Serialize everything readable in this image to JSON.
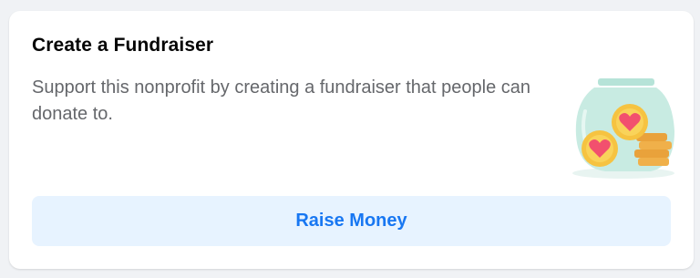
{
  "card": {
    "title": "Create a Fundraiser",
    "description": "Support this nonprofit by creating a fundraiser that people can donate to.",
    "illustration_icon": "donation-jar-icon",
    "button_label": "Raise Money"
  },
  "colors": {
    "button_bg": "#e7f3ff",
    "button_text": "#1877f2",
    "title_text": "#050505",
    "description_text": "#65676b",
    "page_bg": "#f0f2f5"
  }
}
